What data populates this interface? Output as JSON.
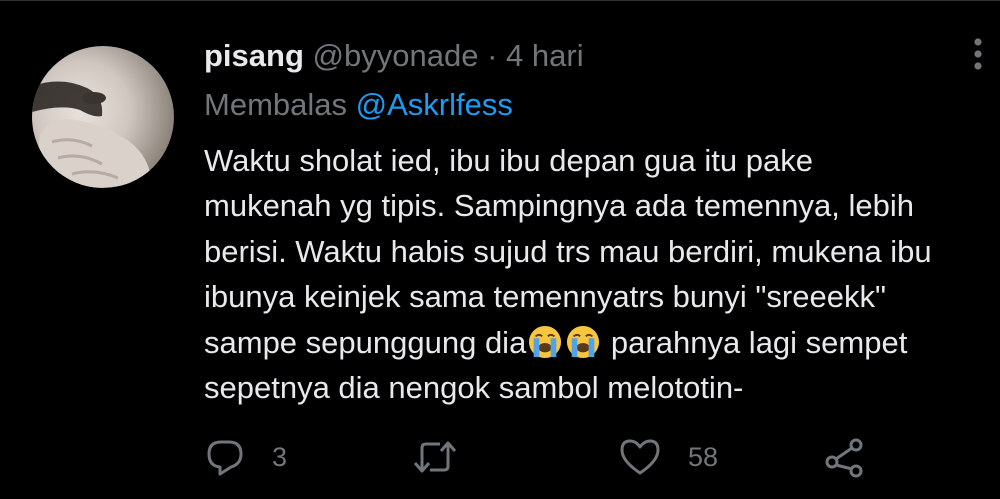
{
  "tweet": {
    "display_name": "pisang",
    "handle": "@byyonade",
    "separator": "·",
    "time": "4 hari",
    "replying_prefix": "Membalas",
    "replying_to": "@Askrlfess",
    "body_lines": [
      "Waktu sholat ied, ibu ibu depan gua itu pake",
      "mukenah yg tipis. Sampingnya ada temennya, lebih",
      "berisi. Waktu habis sujud trs mau berdiri, mukena ibu",
      "ibunya keinjek sama temennyatrs bunyi \"sreeekk\"",
      "sampe sepunggung dia",
      " parahnya lagi sempet",
      "sepetnya dia nengok sambol melototin-"
    ],
    "inline_emoji": [
      "loudly-crying-face",
      "loudly-crying-face"
    ],
    "actions": {
      "reply_count": "3",
      "retweet_count": "",
      "like_count": "58"
    },
    "icons": {
      "reply": "reply-icon",
      "retweet": "retweet-icon",
      "like": "heart-icon",
      "share": "share-icon",
      "more": "more-vertical-icon"
    },
    "colors": {
      "background": "#000000",
      "text": "#e7e9ea",
      "muted": "#71767b",
      "link": "#1d9bf0",
      "emoji_face": "#f7c63e",
      "emoji_tears": "#4fa3e8"
    }
  }
}
